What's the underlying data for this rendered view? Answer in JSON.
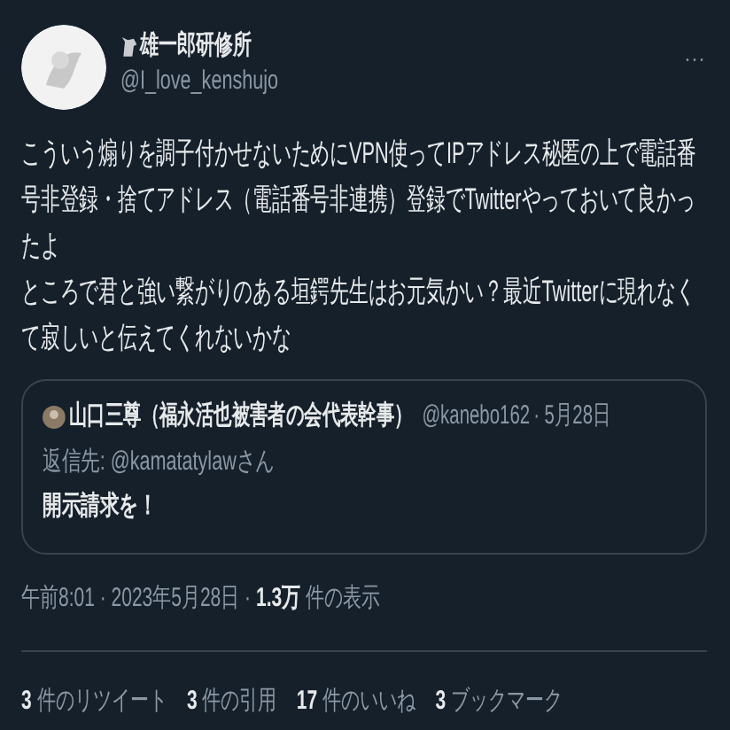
{
  "author": {
    "name": "雄一郎研修所",
    "handle": "@I_love_kenshujo"
  },
  "more": "···",
  "body": [
    "こういう煽りを調子付かせないためにVPN使ってIPアドレス秘匿の上で電話番号非登録・捨てアドレス（電話番号非連携）登録でTwitterやっておいて良かったよ",
    "ところで君と強い繋がりのある垣鍔先生はお元気かい？最近Twitterに現れなくて寂しいと伝えてくれないかな"
  ],
  "quote": {
    "name": "山口三尊（福永活也被害者の会代表幹事）",
    "handle": "@kanebo162",
    "date": "· 5月28日",
    "reply_to": "返信先: @kamatatylawさん",
    "text": "開示請求を！"
  },
  "meta": {
    "time": "午前8:01 · 2023年5月28日 · ",
    "views": "1.3万",
    "views_label": " 件の表示"
  },
  "stats": [
    {
      "count": "3",
      "label": " 件のリツイート"
    },
    {
      "count": "3",
      "label": " 件の引用"
    },
    {
      "count": "17",
      "label": " 件のいいね"
    },
    {
      "count": "3",
      "label": " ブックマーク"
    }
  ]
}
